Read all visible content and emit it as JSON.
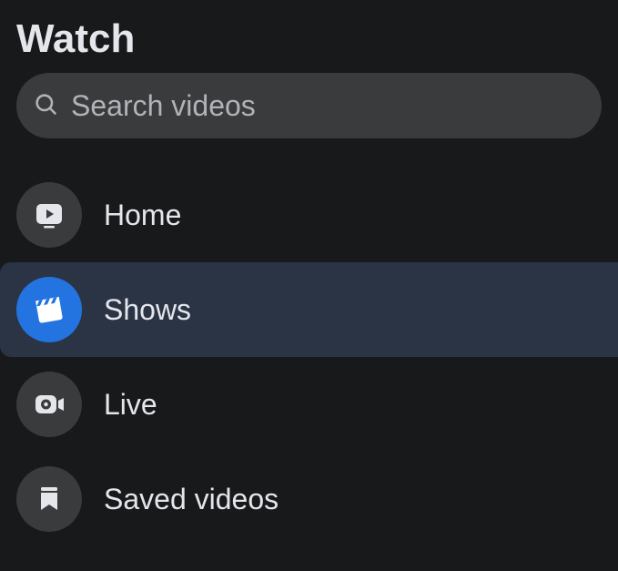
{
  "header": {
    "title": "Watch"
  },
  "search": {
    "placeholder": "Search videos"
  },
  "nav": {
    "items": [
      {
        "label": "Home"
      },
      {
        "label": "Shows"
      },
      {
        "label": "Live"
      },
      {
        "label": "Saved videos"
      }
    ]
  }
}
